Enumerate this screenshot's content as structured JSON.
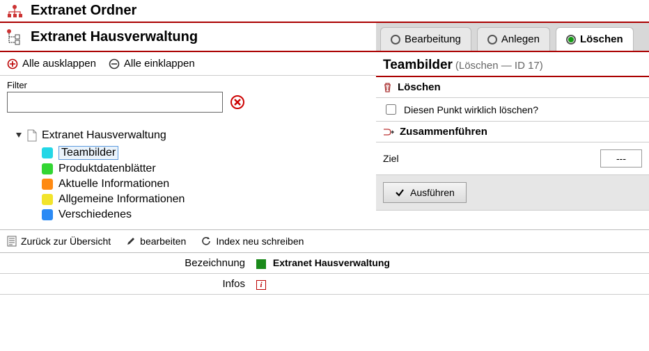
{
  "header": {
    "title": "Extranet Ordner"
  },
  "subheader": {
    "title": "Extranet Hausverwaltung"
  },
  "tabs": [
    {
      "label": "Bearbeitung",
      "active": false
    },
    {
      "label": "Anlegen",
      "active": false
    },
    {
      "label": "Löschen",
      "active": true
    }
  ],
  "expand": {
    "all_expand": "Alle ausklappen",
    "all_collapse": "Alle einklappen"
  },
  "filter": {
    "label": "Filter",
    "value": ""
  },
  "tree": {
    "root": "Extranet Hausverwaltung",
    "items": [
      {
        "label": "Teambilder",
        "color": "#23d7e6",
        "selected": true
      },
      {
        "label": "Produktdatenblätter",
        "color": "#33d633",
        "selected": false
      },
      {
        "label": "Aktuelle Informationen",
        "color": "#ff8a12",
        "selected": false
      },
      {
        "label": "Allgemeine Informationen",
        "color": "#f2e42c",
        "selected": false
      },
      {
        "label": "Verschiedenes",
        "color": "#2a8af5",
        "selected": false
      }
    ]
  },
  "toolbar": {
    "back": "Zurück zur Übersicht",
    "edit": "bearbeiten",
    "reindex": "Index neu schreiben"
  },
  "details": {
    "bezeichnung_label": "Bezeichnung",
    "bezeichnung_value": "Extranet Hausverwaltung",
    "infos_label": "Infos"
  },
  "right_panel": {
    "title": "Teambilder",
    "subtitle": "(Löschen — ID 17)",
    "delete_section": "Löschen",
    "confirm_text": "Diesen Punkt wirklich löschen?",
    "merge_section": "Zusammenführen",
    "target_label": "Ziel",
    "target_value": "---",
    "execute": "Ausführen"
  }
}
